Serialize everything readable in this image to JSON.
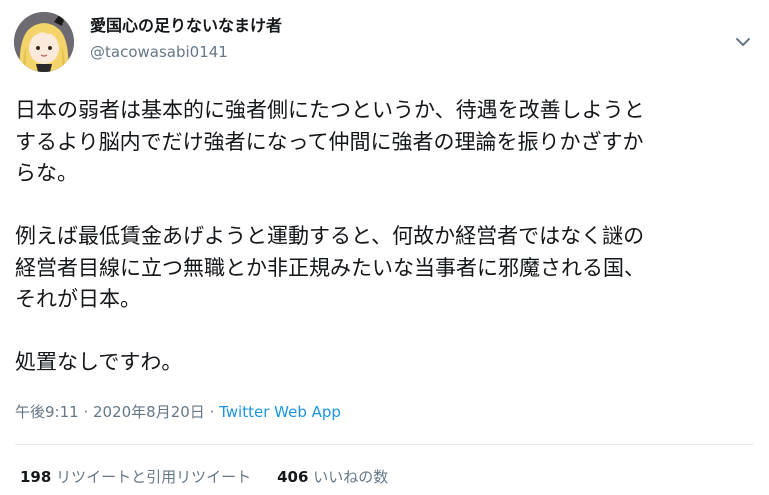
{
  "author": {
    "display_name": "愛国心の足りないなまけ者",
    "handle": "@tacowasabi0141"
  },
  "tweet": {
    "paragraphs": [
      "日本の弱者は基本的に強者側にたつというか、待遇を改善しようと",
      "するより脳内でだけ強者になって仲間に強者の理論を振りかざすか",
      "らな。",
      "",
      "例えば最低賃金あげようと運動すると、何故か経営者ではなく謎の",
      "経営者目線に立つ無職とか非正規みたいな当事者に邪魔される国、",
      "それが日本。",
      "",
      "処置なしですわ。"
    ],
    "timestamp": "午後9:11 · 2020年8月20日",
    "separator": " · ",
    "source": "Twitter Web App"
  },
  "stats": {
    "retweets_count": "198",
    "retweets_label": "リツイートと引用リツイート",
    "likes_count": "406",
    "likes_label": "いいねの数"
  },
  "icons": {
    "chevron": "chevron-down-icon",
    "avatar": "avatar-image"
  },
  "colors": {
    "text_primary": "#14171a",
    "text_secondary": "#657786",
    "link": "#1b95e0",
    "divider": "#e6ecf0"
  }
}
